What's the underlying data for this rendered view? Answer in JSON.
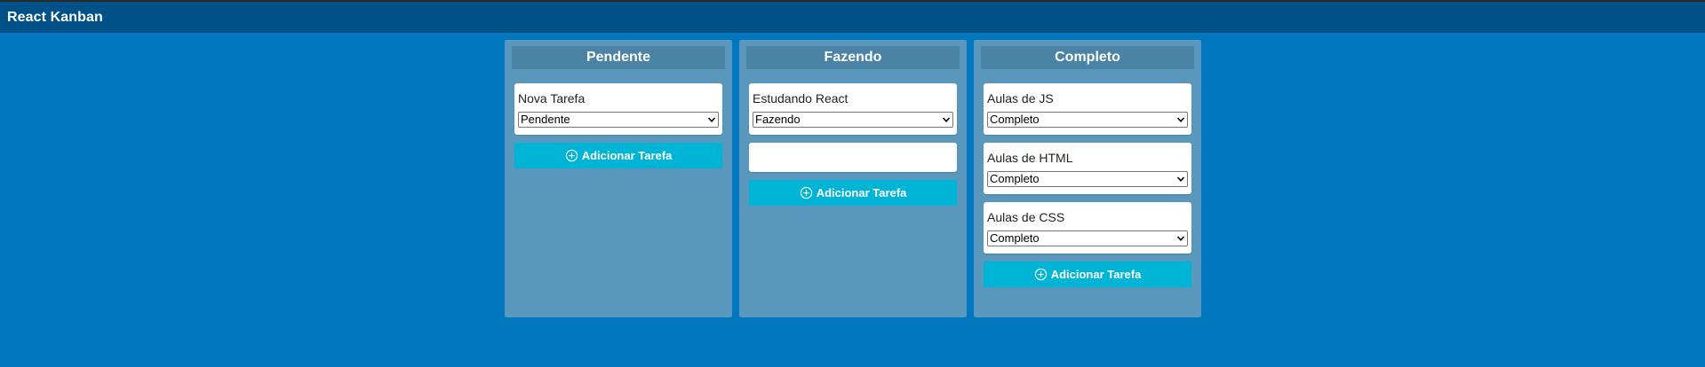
{
  "app": {
    "title": "React Kanban"
  },
  "colors": {
    "background": "#0077be",
    "header": "#005188",
    "column": "#5998bc",
    "column_header": "#4a83a6",
    "add_button": "#00b4d6"
  },
  "columns": [
    {
      "title": "Pendente",
      "cards": [
        {
          "title": "Nova Tarefa",
          "status": "Pendente"
        }
      ],
      "add_label": "Adicionar Tarefa"
    },
    {
      "title": "Fazendo",
      "cards": [
        {
          "title": "Estudando React",
          "status": "Fazendo"
        },
        {
          "title": "",
          "status": ""
        }
      ],
      "add_label": "Adicionar Tarefa"
    },
    {
      "title": "Completo",
      "cards": [
        {
          "title": "Aulas de JS",
          "status": "Completo"
        },
        {
          "title": "Aulas de HTML",
          "status": "Completo"
        },
        {
          "title": "Aulas de CSS",
          "status": "Completo"
        }
      ],
      "add_label": "Adicionar Tarefa"
    }
  ]
}
